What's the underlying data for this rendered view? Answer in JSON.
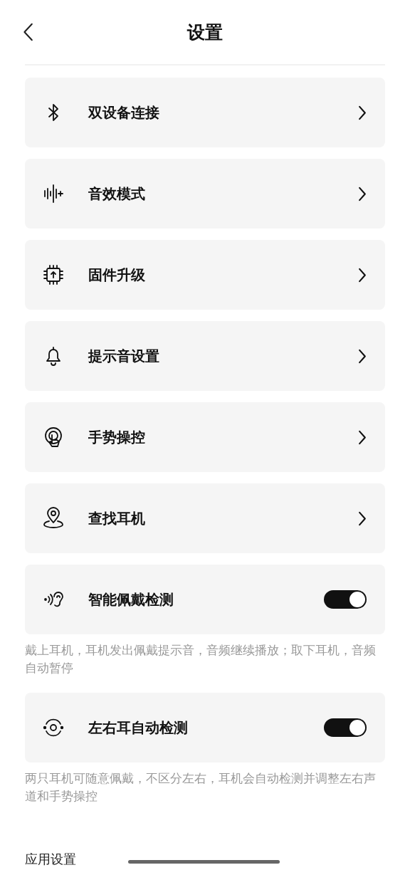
{
  "header": {
    "title": "设置"
  },
  "items": [
    {
      "kind": "link",
      "label": "双设备连接"
    },
    {
      "kind": "link",
      "label": "音效模式"
    },
    {
      "kind": "link",
      "label": "固件升级"
    },
    {
      "kind": "link",
      "label": "提示音设置"
    },
    {
      "kind": "link",
      "label": "手势操控"
    },
    {
      "kind": "link",
      "label": "查找耳机"
    },
    {
      "kind": "toggle",
      "label": "智能佩戴检测",
      "on": true,
      "description": "戴上耳机，耳机发出佩戴提示音，音频继续播放；取下耳机，音频自动暂停"
    },
    {
      "kind": "toggle",
      "label": "左右耳自动检测",
      "on": true,
      "description": "两只耳机可随意佩戴，不区分左右，耳机会自动检测并调整左右声道和手势操控"
    }
  ],
  "section_title": "应用设置"
}
